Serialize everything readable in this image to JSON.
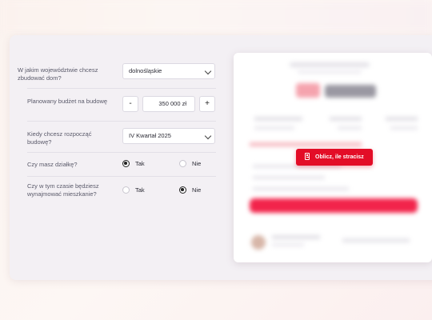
{
  "form": {
    "region": {
      "label": "W jakim województwie chcesz zbudować dom?",
      "value": "dolnośląskie"
    },
    "budget": {
      "label": "Planowany budżet na budowę",
      "value": "350 000 zł",
      "minus": "-",
      "plus": "+"
    },
    "when": {
      "label": "Kiedy chcesz rozpocząć budowę?",
      "value": "IV Kwartał 2025"
    },
    "plot": {
      "label": "Czy masz działkę?",
      "yes": "Tak",
      "no": "Nie",
      "selected": "Tak"
    },
    "rent": {
      "label": "Czy w tym czasie będziesz wynajmować mieszkanie?",
      "yes": "Tak",
      "no": "Nie",
      "selected": "Nie"
    }
  },
  "preview": {
    "button_label": "Oblicz, ile stracisz"
  },
  "colors": {
    "accent": "#e30d27",
    "panel": "#f3f0f4"
  }
}
